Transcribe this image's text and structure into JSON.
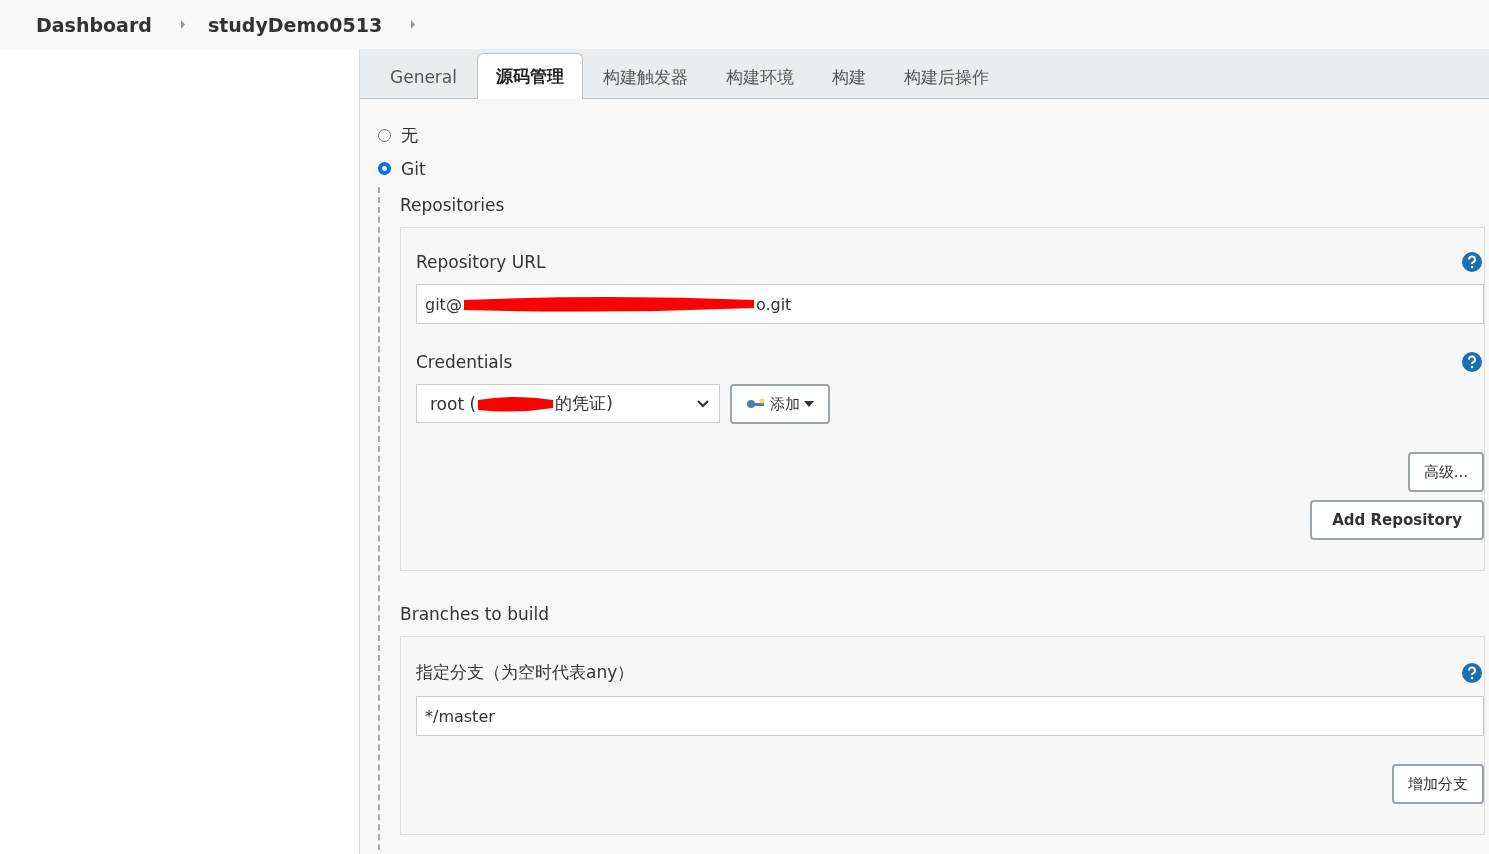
{
  "breadcrumb": [
    "Dashboard",
    "studyDemo0513"
  ],
  "tabs": [
    {
      "label": "General",
      "selected": false
    },
    {
      "label": "源码管理",
      "selected": true
    },
    {
      "label": "构建触发器",
      "selected": false
    },
    {
      "label": "构建环境",
      "selected": false
    },
    {
      "label": "构建",
      "selected": false
    },
    {
      "label": "构建后操作",
      "selected": false
    }
  ],
  "scm_options": [
    {
      "label": "无",
      "selected": false
    },
    {
      "label": "Git",
      "selected": true
    }
  ],
  "repositories": {
    "title": "Repositories",
    "url": {
      "label": "Repository URL",
      "visible_parts": [
        "git@",
        "o.git"
      ]
    },
    "credentials": {
      "label": "Credentials",
      "visible_parts": [
        "root (",
        "的凭证)"
      ],
      "add_button": "添加"
    },
    "advanced_button": "高级...",
    "add_repository_button": "Add Repository"
  },
  "branches": {
    "title": "Branches to build",
    "label": "指定分支（为空时代表any）",
    "value": "*/master",
    "add_branch_button": "增加分支"
  }
}
